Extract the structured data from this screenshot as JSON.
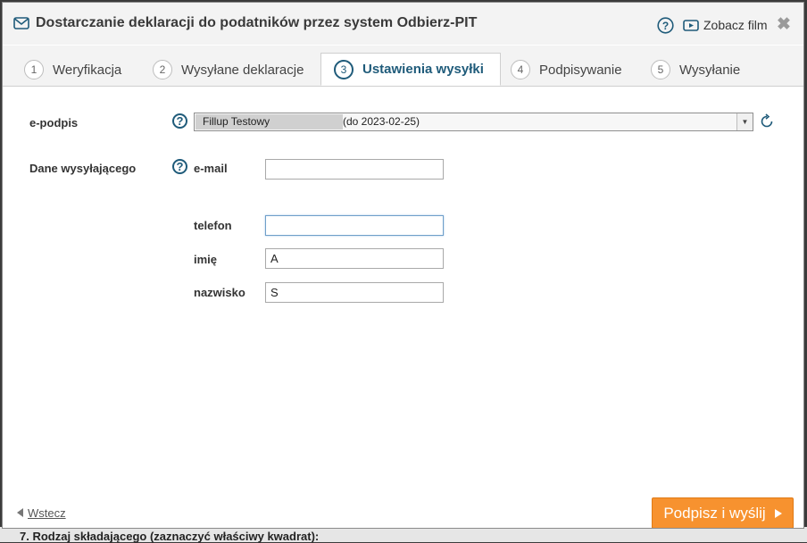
{
  "background": {
    "peek_text": "7. Rodzaj składającego (zaznaczyć właściwy kwadrat):"
  },
  "dialog": {
    "title": "Dostarczanie deklaracji do podatników przez system Odbierz-PIT",
    "film_label": "Zobacz film",
    "close_symbol": "✖"
  },
  "tabs": [
    {
      "num": "1",
      "label": "Weryfikacja"
    },
    {
      "num": "2",
      "label": "Wysyłane deklaracje"
    },
    {
      "num": "3",
      "label": "Ustawienia wysyłki",
      "active": true
    },
    {
      "num": "4",
      "label": "Podpisywanie"
    },
    {
      "num": "5",
      "label": "Wysyłanie"
    }
  ],
  "form": {
    "epodpis_label": "e-podpis",
    "epodpis_name": "Fillup Testowy",
    "epodpis_validity": "(do 2023-02-25)",
    "sender_label": "Dane wysyłającego",
    "email_label": "e-mail",
    "email_value": "",
    "phone_label": "telefon",
    "phone_value": "",
    "firstname_label": "imię",
    "firstname_value": "A",
    "lastname_label": "nazwisko",
    "lastname_value": "S"
  },
  "footer": {
    "back_label": "Wstecz",
    "submit_label": "Podpisz i wyślij"
  },
  "colors": {
    "accent": "#1f5b7a",
    "submit": "#f7922f"
  }
}
